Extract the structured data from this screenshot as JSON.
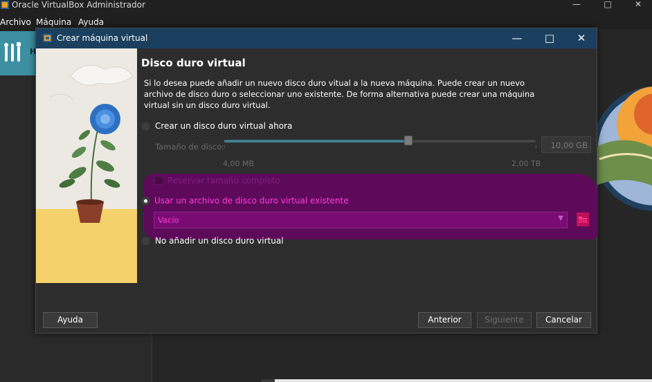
{
  "main_window": {
    "title": "Oracle VirtualBox Administrador",
    "menu": [
      "Archivo",
      "Máquina",
      "Ayuda"
    ],
    "tools_letter": "H",
    "controls": {
      "minimize": "—",
      "maximize": "□",
      "close": "✕"
    }
  },
  "dialog": {
    "title": "Crear máquina virtual",
    "page_title": "Disco duro virtual",
    "description": "Si lo desea puede añadir un nuevo disco duro vitual a la nueva máquina. Puede crear un nuevo archivo de disco duro o seleccionar uno existente. De forma alternativa puede crear una máquina virtual sin un disco duro virtual.",
    "options": {
      "create_new": "Crear un disco duro virtual ahora",
      "use_existing": "Usar un archivo de disco duro virtual existente",
      "no_disk": "No añadir un disco duro virtual"
    },
    "selected_option": "use_existing",
    "disk_size": {
      "label": "Tamaño de disco:",
      "value": "10,00 GB",
      "min_label": "4,00 MB",
      "max_label": "2,00 TB",
      "slider_fraction": 0.59
    },
    "reserve_label": "Reservar tamaño completo",
    "existing_file_value": "Vacío",
    "buttons": {
      "help": "Ayuda",
      "back": "Anterior",
      "next": "Siguiente",
      "cancel": "Cancelar"
    },
    "controls": {
      "minimize": "—",
      "maximize": "□",
      "close": "✕"
    },
    "colors": {
      "titlebar": "#1b3f5e",
      "highlight": "#5e0a5b",
      "highlight_text": "#ff3fd8"
    }
  }
}
